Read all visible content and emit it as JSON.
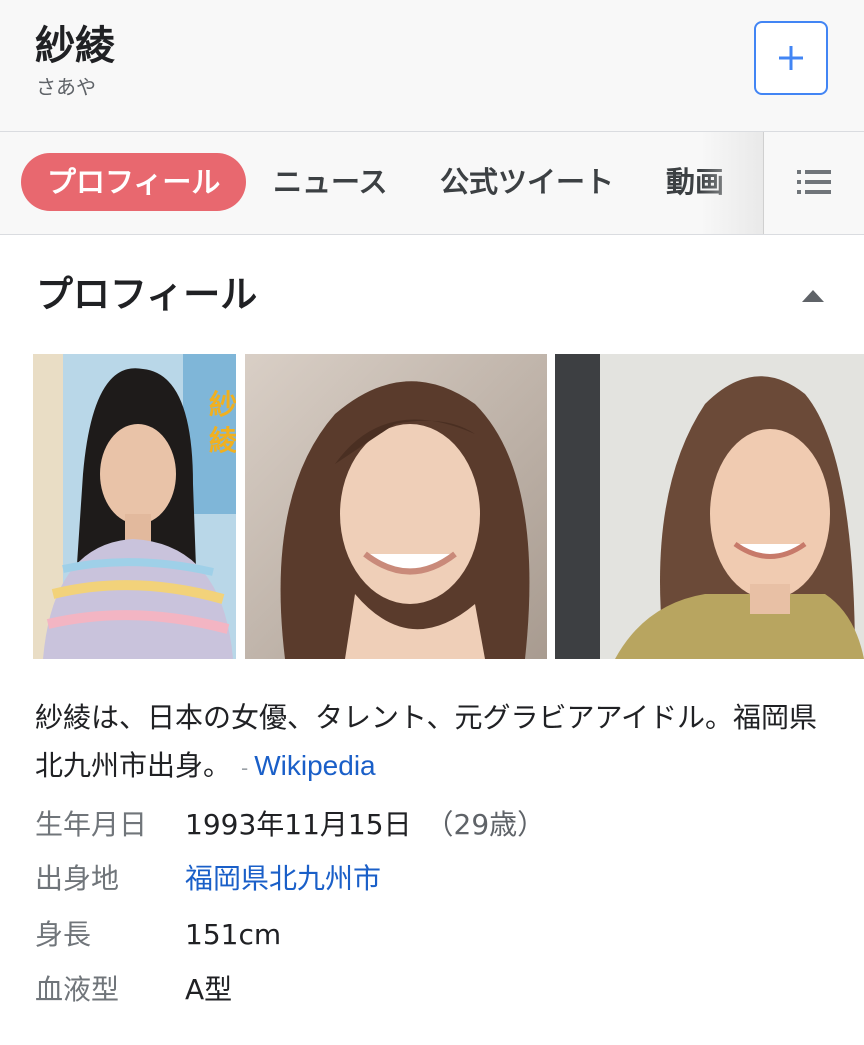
{
  "header": {
    "title": "紗綾",
    "subtitle": "さあや",
    "add_icon": "plus-icon"
  },
  "tabs": [
    {
      "label": "プロフィール",
      "active": true
    },
    {
      "label": "ニュース",
      "active": false
    },
    {
      "label": "公式ツイート",
      "active": false
    },
    {
      "label": "動画",
      "active": false
    }
  ],
  "menu_icon": "list-icon",
  "section": {
    "title": "プロフィール",
    "collapse_icon": "triangle-up-icon"
  },
  "images": [
    {
      "name": "profile-photo-1"
    },
    {
      "name": "profile-photo-2"
    },
    {
      "name": "profile-photo-3"
    }
  ],
  "description": {
    "text": "紗綾は、日本の女優、タレント、元グラビアアイドル。福岡県北九州市出身。",
    "separator": "-",
    "source": "Wikipedia"
  },
  "facts": {
    "birthdate": {
      "label": "生年月日",
      "value": "1993年11月15日",
      "age": "（29歳）"
    },
    "birthplace": {
      "label": "出身地",
      "value": "福岡県北九州市"
    },
    "height": {
      "label": "身長",
      "value": "151cm"
    },
    "blood_type": {
      "label": "血液型",
      "value": "A型"
    }
  },
  "colors": {
    "active_tab": "#e8686f",
    "accent_blue": "#4285f4",
    "link": "#1a5fc8"
  }
}
